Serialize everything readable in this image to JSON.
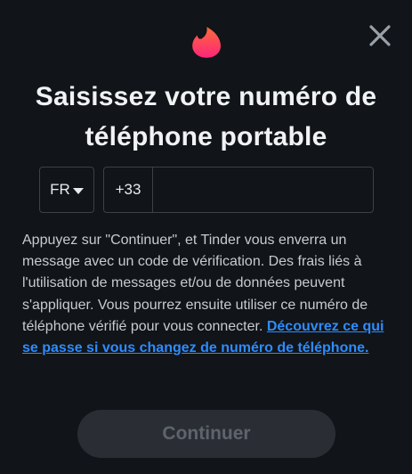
{
  "dialog": {
    "title": "Saisissez votre numéro de téléphone portable",
    "close_icon": "close-icon",
    "logo_icon": "flame-logo"
  },
  "phone": {
    "country_code": "FR",
    "dial_prefix": "+33",
    "number_value": "",
    "number_placeholder": ""
  },
  "description": {
    "text": "Appuyez sur \"Continuer\", et Tinder vous enverra un message avec un code de vérification. Des frais liés à l'utilisation de messages et/ou de données peuvent s'appliquer. Vous pourrez ensuite utiliser ce numéro de téléphone vérifié pour vous connecter. ",
    "link_text": "Découvrez ce qui se passe si vous changez de numéro de téléphone."
  },
  "actions": {
    "continue_label": "Continuer"
  },
  "colors": {
    "background": "#111418",
    "link": "#2d8cff",
    "brand_gradient_top": "#ff6a3a",
    "brand_gradient_bottom": "#fd267a",
    "button_disabled_bg": "#2a2e34",
    "button_disabled_text": "#5e646d"
  }
}
